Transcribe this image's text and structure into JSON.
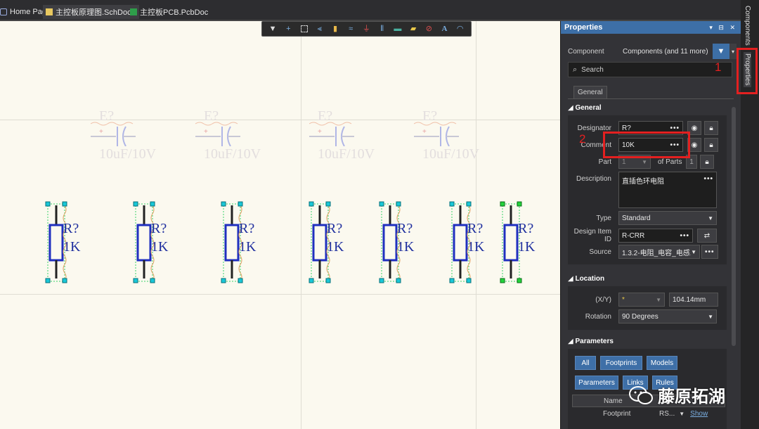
{
  "tabs": [
    {
      "label": "Home Page"
    },
    {
      "label": "主控板原理图.SchDoc *"
    },
    {
      "label": "主控板PCB.PcbDoc"
    }
  ],
  "toolbar_icons": [
    "filter-icon",
    "add-icon",
    "select-rect-icon",
    "align-icon",
    "part-icon",
    "wire-icon",
    "power-icon",
    "bus-icon",
    "port-icon",
    "net-label-icon",
    "directive-icon",
    "text-icon",
    "arc-icon"
  ],
  "capacitors": [
    {
      "designator": "E?",
      "value": "10uF/10V"
    },
    {
      "designator": "E?",
      "value": "10uF/10V"
    },
    {
      "designator": "E?",
      "value": "10uF/10V"
    },
    {
      "designator": "E?",
      "value": "10uF/10V"
    }
  ],
  "resistors": [
    {
      "designator": "R?",
      "value": "1K"
    },
    {
      "designator": "R?",
      "value": "1K"
    },
    {
      "designator": "R?",
      "value": "1K"
    },
    {
      "designator": "R?",
      "value": "1K"
    },
    {
      "designator": "R?",
      "value": "1K"
    },
    {
      "designator": "R?",
      "value": "1K"
    },
    {
      "designator": "R?",
      "value": "1K"
    }
  ],
  "properties": {
    "title": "Properties",
    "component_label": "Component",
    "component_value": "Components (and 11 more)",
    "search_placeholder": "Search",
    "general_tab": "General",
    "general_section": "General",
    "designator_label": "Designator",
    "designator_value": "R?",
    "comment_label": "Comment",
    "comment_value": "10K",
    "part_label": "Part",
    "part_value": "1",
    "of_parts_label": "of Parts",
    "of_parts_value": "1",
    "description_label": "Description",
    "description_value": "直插色环电阻",
    "type_label": "Type",
    "type_value": "Standard",
    "design_item_label": "Design Item ID",
    "design_item_value": "R-CRR",
    "source_label": "Source",
    "source_value": "1.3.2-电阻_电容_电感.",
    "location_section": "Location",
    "xy_label": "(X/Y)",
    "x_value": "*",
    "y_value": "104.14mm",
    "rotation_label": "Rotation",
    "rotation_value": "90 Degrees",
    "parameters_section": "Parameters",
    "chips": [
      "All",
      "Footprints",
      "Models",
      "Parameters",
      "Links",
      "Rules"
    ],
    "table_header": "Name",
    "footprint_name": "Footprint",
    "footprint_value": "RS...",
    "footprint_action": "Show"
  },
  "side_tabs": {
    "components": "Components",
    "properties": "Properties"
  },
  "annotations": {
    "one": "1",
    "two": "2"
  },
  "watermark": "藤原拓湖",
  "colors": {
    "accent": "#3d6fa7",
    "highlight": "#e32020",
    "schematic_blue": "#1f2f9f"
  }
}
